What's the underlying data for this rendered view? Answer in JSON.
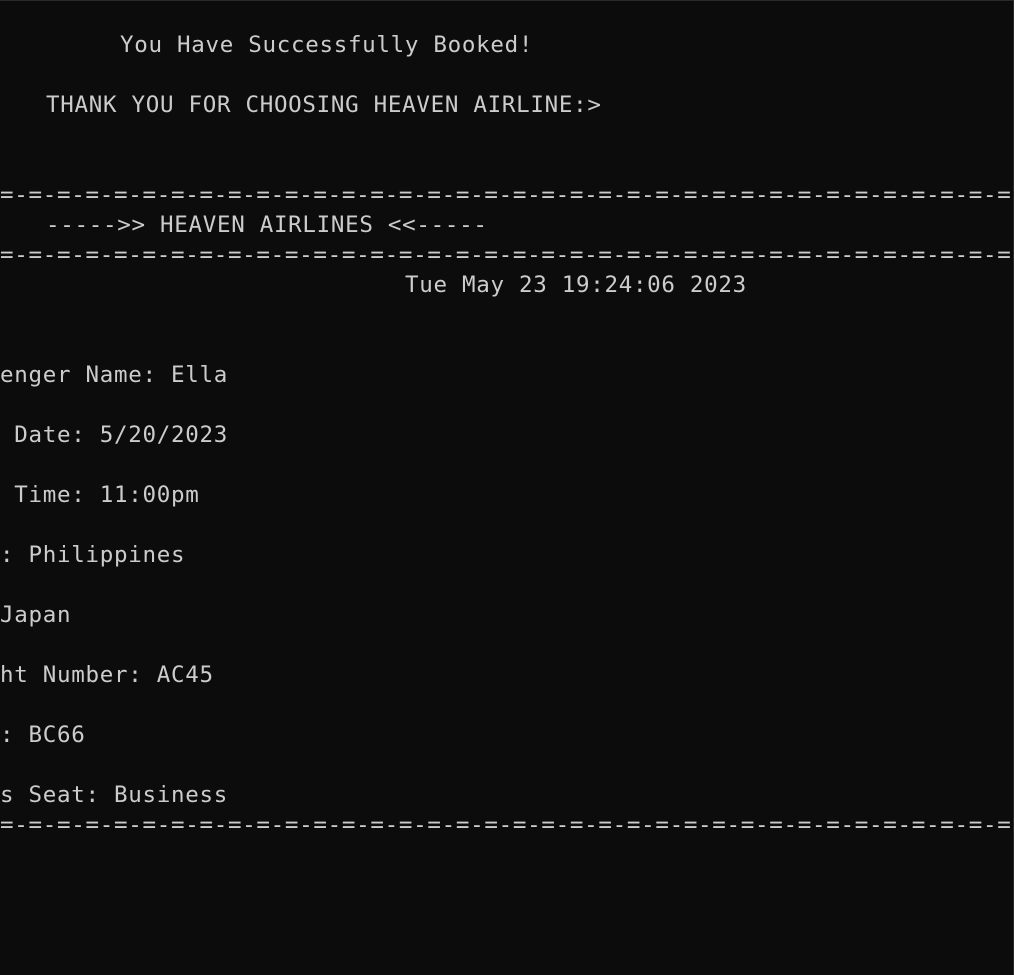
{
  "console": {
    "success_message": "You Have Successfully Booked!",
    "thank_you_message": "THANK YOU FOR CHOOSING HEAVEN AIRLINE:>",
    "separator_top": "=-=-=-=-=-=-=-=-=-=-=-=-=-=-=-=-=-=-=-=-=-=-=-=-=-=-=-=-=-=-=-=-=-=-=-=-=-=-=-=-=",
    "banner": "----->> HEAVEN AIRLINES <<-----",
    "separator_mid": "=-=-=-=-=-=-=-=-=-=-=-=-=-=-=-=-=-=-=-=-=-=-=-=-=-=-=-=-=-=-=-=-=-=-=-=-=-=-=-=-=",
    "timestamp": "Tue May 23 19:24:06 2023",
    "passenger_name": "enger Name: Ella",
    "flight_date": " Date: 5/20/2023",
    "flight_time": " Time: 11:00pm",
    "origin": ": Philippines",
    "destination": "Japan",
    "flight_number": "ht Number: AC45",
    "seat_code": ": BC66",
    "class_seat": "s Seat: Business",
    "separator_bottom": "=-=-=-=-=-=-=-=-=-=-=-=-=-=-=-=-=-=-=-=-=-=-=-=-=-=-=-=-=-=-=-=-=-=-=-=-=-=-=-=-="
  }
}
